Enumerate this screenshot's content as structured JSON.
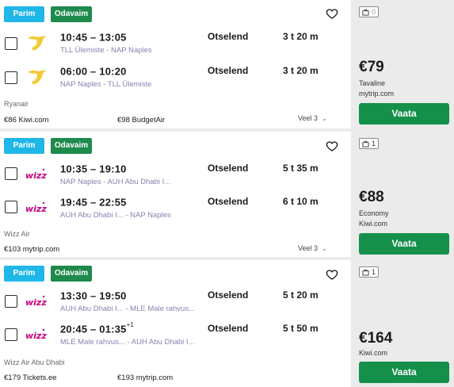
{
  "cards": [
    {
      "tag_best": "Parim",
      "tag_cheap": "Odavaim",
      "legs": [
        {
          "times": "10:45 – 13:05",
          "plus": "",
          "route": "TLL Ülemiste - NAP Naples",
          "stops": "Otselend",
          "duration": "3 t 20 m"
        },
        {
          "times": "06:00 – 10:20",
          "plus": "",
          "route": "NAP Naples - TLL Ülemiste",
          "stops": "Otselend",
          "duration": "3 t 20 m"
        }
      ],
      "airline": "Ryanair",
      "providers": [
        "€86 Kiwi.com",
        "€98 BudgetAir"
      ],
      "more": "Veel 3",
      "bags": "0",
      "price": "€79",
      "class": "Tavaline",
      "site": "mytrip.com",
      "cta": "Vaata",
      "logo": "ryanair-harp"
    },
    {
      "tag_best": "Parim",
      "tag_cheap": "Odavaim",
      "legs": [
        {
          "times": "10:35 – 19:10",
          "plus": "",
          "route": "NAP Naples - AUH Abu Dhabi I...",
          "stops": "Otselend",
          "duration": "5 t 35 m"
        },
        {
          "times": "19:45 – 22:55",
          "plus": "",
          "route": "AUH Abu Dhabi I... - NAP Naples",
          "stops": "Otselend",
          "duration": "6 t 10 m"
        }
      ],
      "airline": "Wizz Air",
      "providers": [
        "€103 mytrip.com"
      ],
      "more": "Veel 3",
      "bags": "1",
      "price": "€88",
      "class": "Economy",
      "site": "Kiwi.com",
      "cta": "Vaata",
      "logo": "wizz"
    },
    {
      "tag_best": "Parim",
      "tag_cheap": "Odavaim",
      "legs": [
        {
          "times": "13:30 – 19:50",
          "plus": "",
          "route": "AUH Abu Dhabi I... - MLE Male rahvus...",
          "stops": "Otselend",
          "duration": "5 t 20 m"
        },
        {
          "times": "20:45 – 01:35",
          "plus": "+1",
          "route": "MLE Male rahvus... - AUH Abu Dhabi I...",
          "stops": "Otselend",
          "duration": "5 t 50 m"
        }
      ],
      "airline": "Wizz Air Abu Dhabi",
      "providers": [
        "€179 Tickets.ee",
        "€193 mytrip.com"
      ],
      "more": "",
      "bags": "1",
      "price": "€164",
      "class": "",
      "site": "Kiwi.com",
      "cta": "Vaata",
      "logo": "wizz"
    }
  ],
  "colors": {
    "best": "#1fb6e8",
    "cheap": "#1e8a4c",
    "cta": "#14904b",
    "route": "#8a7fb0"
  },
  "icons": {
    "favorite": "heart-icon",
    "bag": "cabin-bag-icon",
    "expand": "chevron-down-icon"
  }
}
